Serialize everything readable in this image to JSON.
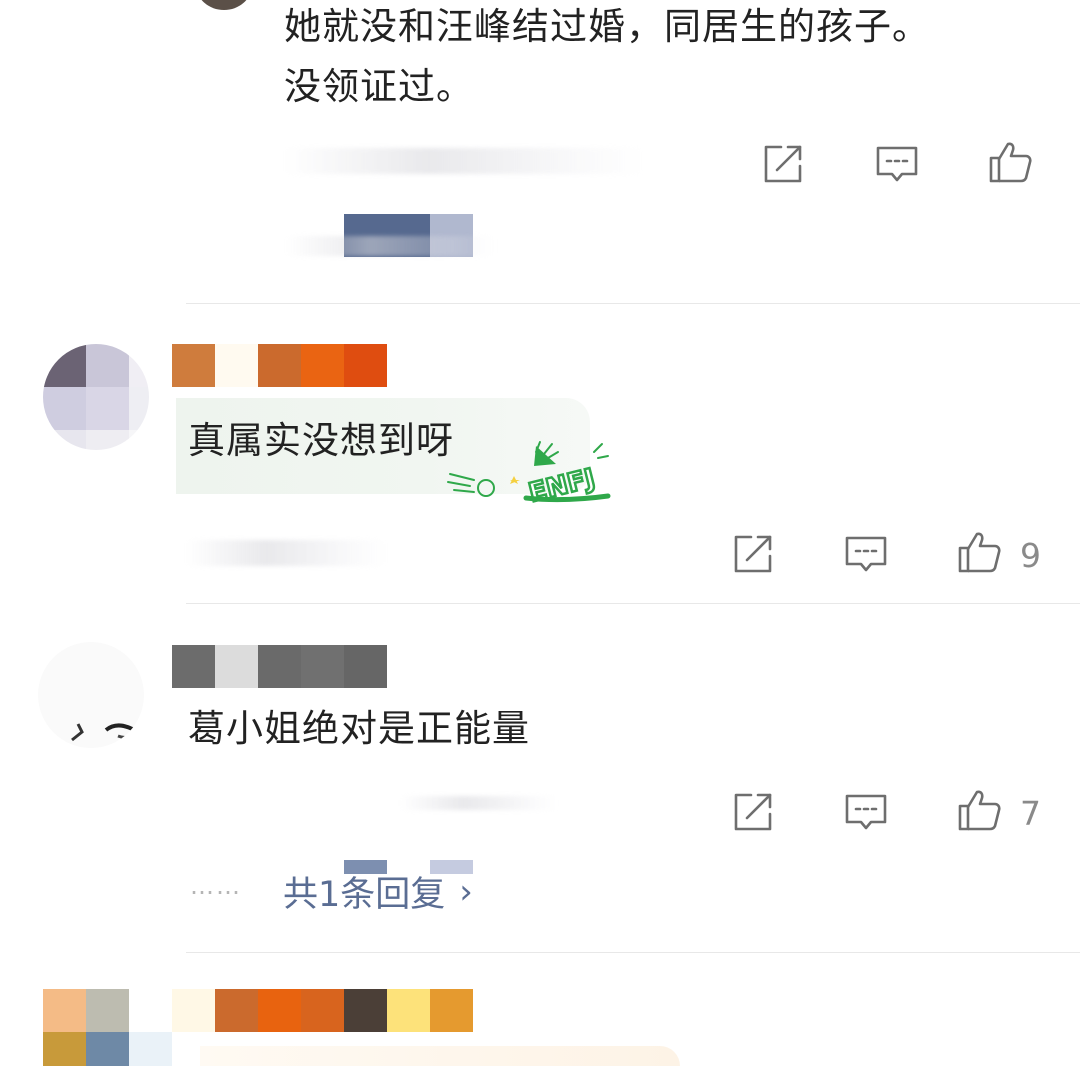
{
  "comments": [
    {
      "text_line1": "她就没和汪峰结过婚，同居生的孩子。",
      "text_line2": "没领证过。",
      "like_count": ""
    },
    {
      "text": "真属实没想到呀",
      "badge_text": "ENFJ",
      "like_count": "9"
    },
    {
      "text": "葛小姐绝对是正能量",
      "like_count": "7",
      "reply_dots": "……",
      "reply_link": "共1条回复",
      "reply_chevron": "›"
    }
  ],
  "icons": {
    "share": "share-icon",
    "comment": "comment-icon",
    "like": "thumbs-up-icon"
  },
  "colors": {
    "link": "#5a6d93",
    "icon": "#6e6e6e",
    "count": "#8a8a8a",
    "badge_green": "#2fa84a"
  }
}
